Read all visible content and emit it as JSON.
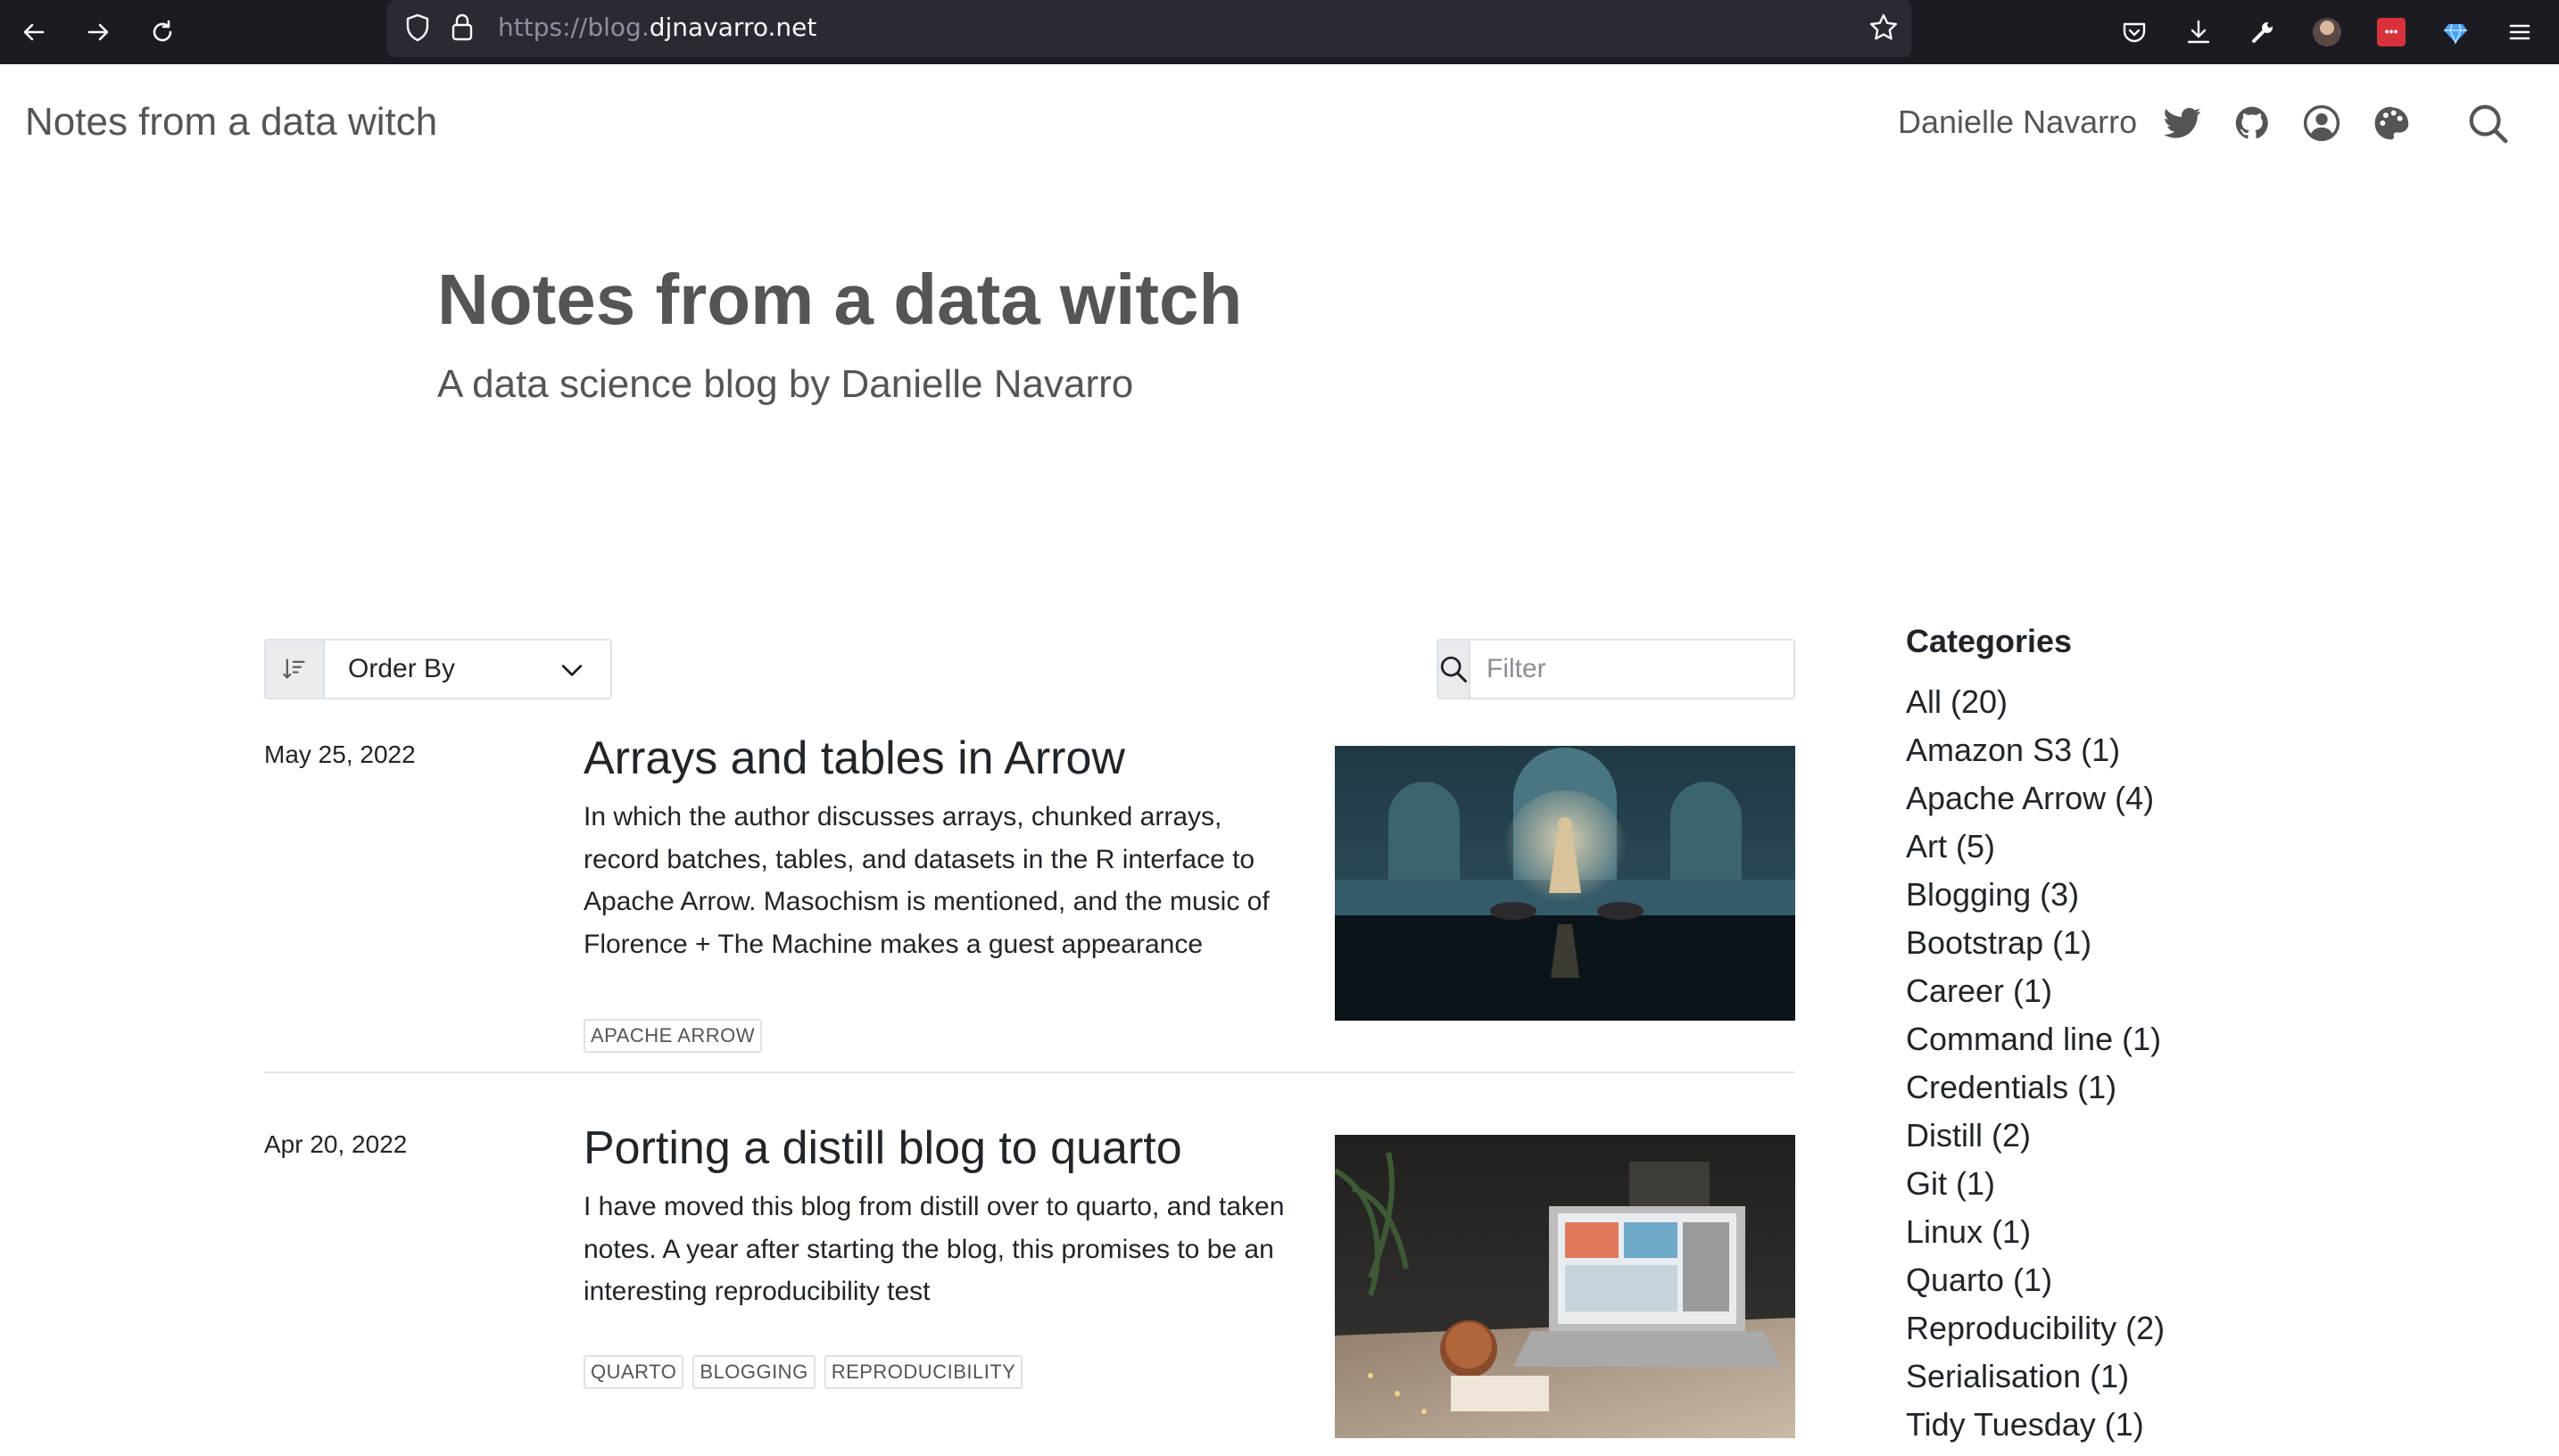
{
  "browser": {
    "url_prefix": "https://blog.",
    "url_domain": "djnavarro.net"
  },
  "navbar": {
    "brand": "Notes from a data witch",
    "author": "Danielle Navarro",
    "icons": [
      "twitter-icon",
      "github-icon",
      "user-circle-icon",
      "palette-icon",
      "search-icon"
    ]
  },
  "hero": {
    "title": "Notes from a data witch",
    "subtitle": "A data science blog by Danielle Navarro"
  },
  "controls": {
    "order_by_label": "Order By",
    "filter_placeholder": "Filter"
  },
  "posts": [
    {
      "date": "May 25, 2022",
      "title": "Arrays and tables in Arrow",
      "description": "In which the author discusses arrays, chunked arrays, record batches, tables, and datasets in the R interface to Apache Arrow. Masochism is mentioned, and the music of Florence + The Machine makes a guest appearance",
      "tags": [
        "APACHE ARROW"
      ]
    },
    {
      "date": "Apr 20, 2022",
      "title": "Porting a distill blog to quarto",
      "description": "I have moved this blog from distill over to quarto, and taken notes. A year after starting the blog, this promises to be an interesting reproducibility test",
      "tags": [
        "QUARTO",
        "BLOGGING",
        "REPRODUCIBILITY"
      ]
    }
  ],
  "sidebar": {
    "title": "Categories",
    "categories": [
      "All (20)",
      "Amazon S3 (1)",
      "Apache Arrow (4)",
      "Art (5)",
      "Blogging (3)",
      "Bootstrap (1)",
      "Career (1)",
      "Command line (1)",
      "Credentials (1)",
      "Distill (2)",
      "Git (1)",
      "Linux (1)",
      "Quarto (1)",
      "Reproducibility (2)",
      "Serialisation (1)",
      "Tidy Tuesday (1)"
    ]
  },
  "colors": {
    "chrome_bg": "#1c1b22",
    "urlbar_bg": "#2b2a33",
    "heading_gray": "#545555",
    "text": "#212529",
    "border": "#dee2e6"
  }
}
